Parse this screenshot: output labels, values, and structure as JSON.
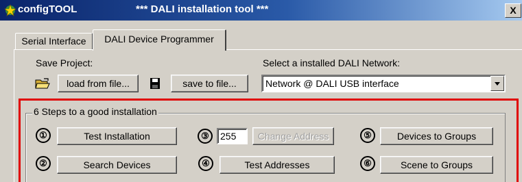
{
  "titlebar": {
    "app_name": "configTOOL",
    "window_title": "*** DALI installation tool ***",
    "close_label": "X",
    "gradient_colors": [
      "#0a246a",
      "#a6caf0"
    ]
  },
  "tabs": [
    {
      "label": "Serial Interface",
      "selected": false
    },
    {
      "label": "DALI Device Programmer",
      "selected": true
    }
  ],
  "project": {
    "save_label": "Save Project:",
    "load_button": "load from file...",
    "save_button": "save to file...",
    "load_icon": "open-folder-icon",
    "save_icon": "floppy-disk-icon"
  },
  "network": {
    "label": "Select a installed DALI Network:",
    "selected": "Network @ DALI USB interface"
  },
  "steps": {
    "legend": "6 Steps to a good installation",
    "highlight_color": "#e00000",
    "numbers": [
      "①",
      "②",
      "③",
      "④",
      "⑤",
      "⑥"
    ],
    "test_installation": "Test Installation",
    "search_devices": "Search Devices",
    "address_value": "255",
    "change_address": "Change Address",
    "test_addresses": "Test Addresses",
    "devices_to_groups": "Devices to Groups",
    "scene_to_groups": "Scene to Groups"
  }
}
